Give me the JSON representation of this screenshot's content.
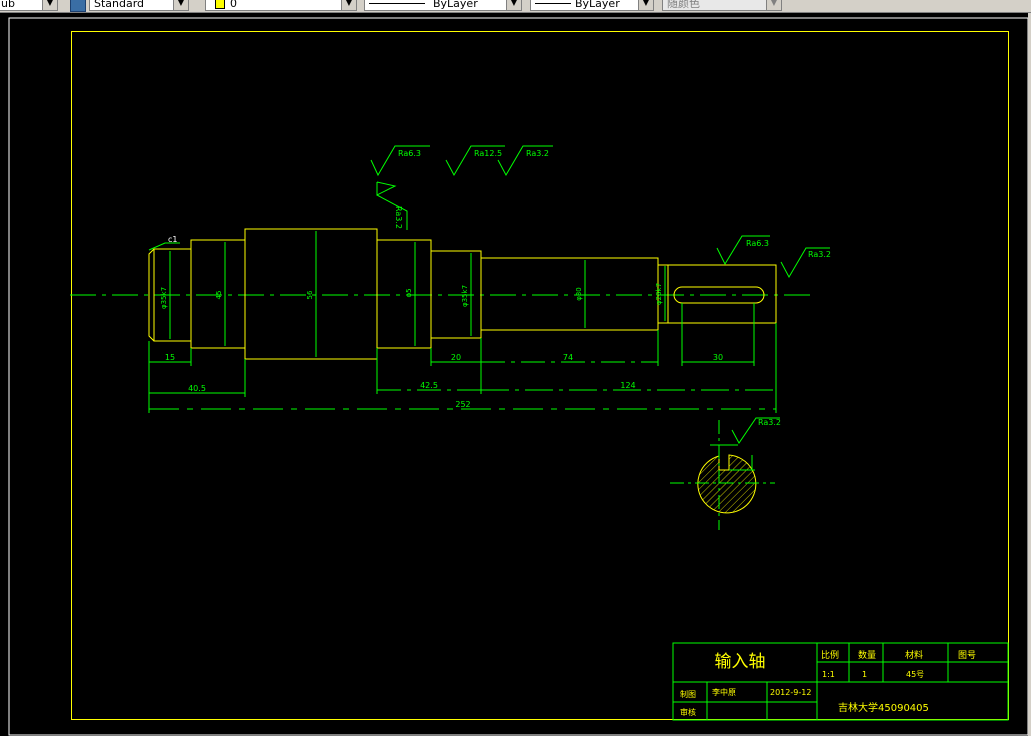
{
  "toolbar": {
    "style_combo": "ub",
    "text_style": "Standard",
    "layer": "0",
    "linetype": "ByLayer",
    "lineweight": "ByLayer",
    "plot_style": "随颜色"
  },
  "drawing": {
    "surface_marks": {
      "top_left": "Ra6.3",
      "top_mid": "Ra12.5",
      "top_right": "Ra3.2",
      "vertical": "Ra3.2",
      "keyway_left": "Ra6.3",
      "keyway_right": "Ra3.2",
      "section": "Ra3.2"
    },
    "chamfer": "c1",
    "diameters": {
      "d1": "φ35k7",
      "d2": "45",
      "d3": "56",
      "d4": "φ5",
      "d5": "φ35k7",
      "d6": "φ30",
      "d7": "φ28k7"
    },
    "lengths": {
      "l15": "15",
      "l40_5": "40.5",
      "l20": "20",
      "l74": "74",
      "l30": "30",
      "l42_5": "42.5",
      "l124": "124",
      "l252": "252"
    }
  },
  "title_block": {
    "part_name": "输入轴",
    "scale_label": "比例",
    "qty_label": "数量",
    "material_label": "材料",
    "drawing_no_label": "图号",
    "scale": "1:1",
    "qty": "1",
    "material": "45号",
    "drawn_by_label": "制图",
    "drawer": "李中原",
    "date": "2012-9-12",
    "checked_label": "审核",
    "school": "吉林大学45090405"
  }
}
